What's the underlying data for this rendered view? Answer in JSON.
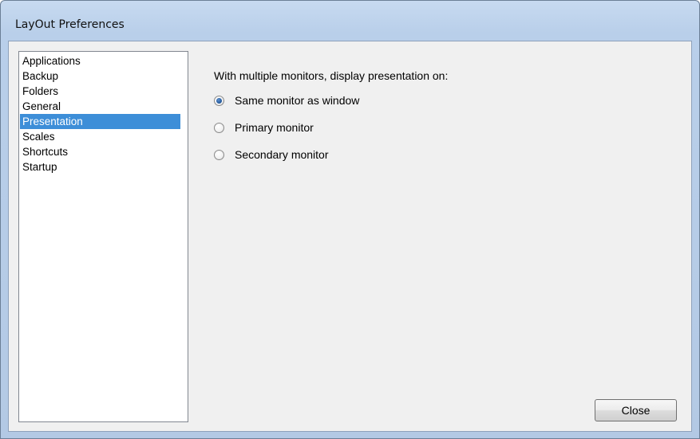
{
  "window": {
    "title": "LayOut Preferences"
  },
  "sidebar": {
    "items": [
      {
        "label": "Applications",
        "selected": false
      },
      {
        "label": "Backup",
        "selected": false
      },
      {
        "label": "Folders",
        "selected": false
      },
      {
        "label": "General",
        "selected": false
      },
      {
        "label": "Presentation",
        "selected": true
      },
      {
        "label": "Scales",
        "selected": false
      },
      {
        "label": "Shortcuts",
        "selected": false
      },
      {
        "label": "Startup",
        "selected": false
      }
    ]
  },
  "presentation": {
    "prompt": "With multiple monitors, display presentation on:",
    "options": [
      {
        "label": "Same monitor as window",
        "checked": true
      },
      {
        "label": "Primary monitor",
        "checked": false
      },
      {
        "label": "Secondary monitor",
        "checked": false
      }
    ]
  },
  "footer": {
    "close_label": "Close"
  },
  "colors": {
    "selection": "#3d8ed8",
    "titlebar": "#c7daf0",
    "client": "#f0f0f0"
  }
}
